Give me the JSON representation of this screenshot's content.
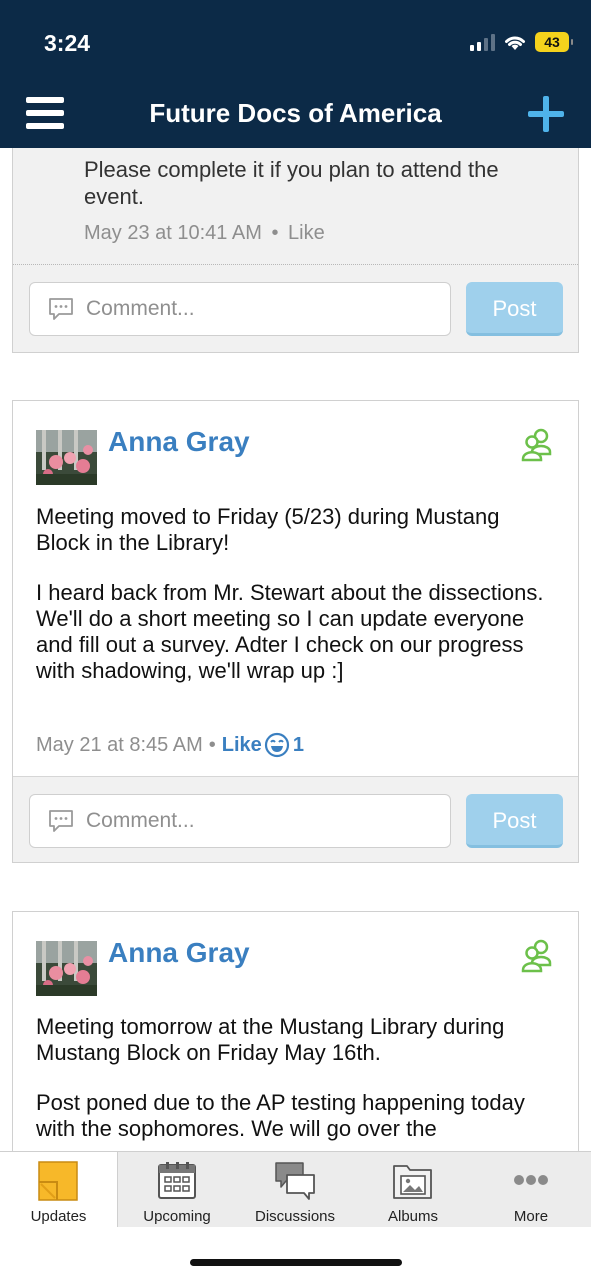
{
  "status_bar": {
    "time": "3:24",
    "battery": "43"
  },
  "header": {
    "title": "Future Docs of America"
  },
  "feed": {
    "continued_post": {
      "text": "Please complete it if you plan to attend the event.",
      "timestamp": "May 23 at 10:41 AM",
      "separator": "•",
      "like_label": "Like"
    },
    "posts": [
      {
        "author": "Anna Gray",
        "paragraphs": [
          "Meeting moved to Friday (5/23) during Mustang Block in the Library!",
          "I heard back from Mr. Stewart about the dissections. We'll do a short meeting so I can update everyone and fill out a survey. Adter I check on our progress with shadowing, we'll wrap up :]"
        ],
        "timestamp": "May 21 at 8:45 AM",
        "separator": "•",
        "like_label": "Like",
        "like_count": "1"
      },
      {
        "author": "Anna Gray",
        "paragraphs": [
          "Meeting tomorrow at the Mustang Library during Mustang Block on Friday May 16th.",
          "Post poned due to the AP testing happening today with the sophomores. We will go over the"
        ]
      }
    ],
    "comment_placeholder": "Comment...",
    "post_button": "Post"
  },
  "tabbar": {
    "tabs": [
      {
        "label": "Updates",
        "icon": "updates-icon",
        "active": true
      },
      {
        "label": "Upcoming",
        "icon": "calendar-icon"
      },
      {
        "label": "Discussions",
        "icon": "discussions-icon"
      },
      {
        "label": "Albums",
        "icon": "albums-icon"
      },
      {
        "label": "More",
        "icon": "more-icon"
      }
    ]
  },
  "colors": {
    "header_bg": "#0c2a47",
    "accent_blue": "#3a7fc0",
    "plus_blue": "#4fb3ea",
    "post_button": "#9fd0ec",
    "member_icon_green": "#6cc04a",
    "updates_icon_yellow": "#f7b829",
    "battery_yellow": "#f5d21c"
  }
}
